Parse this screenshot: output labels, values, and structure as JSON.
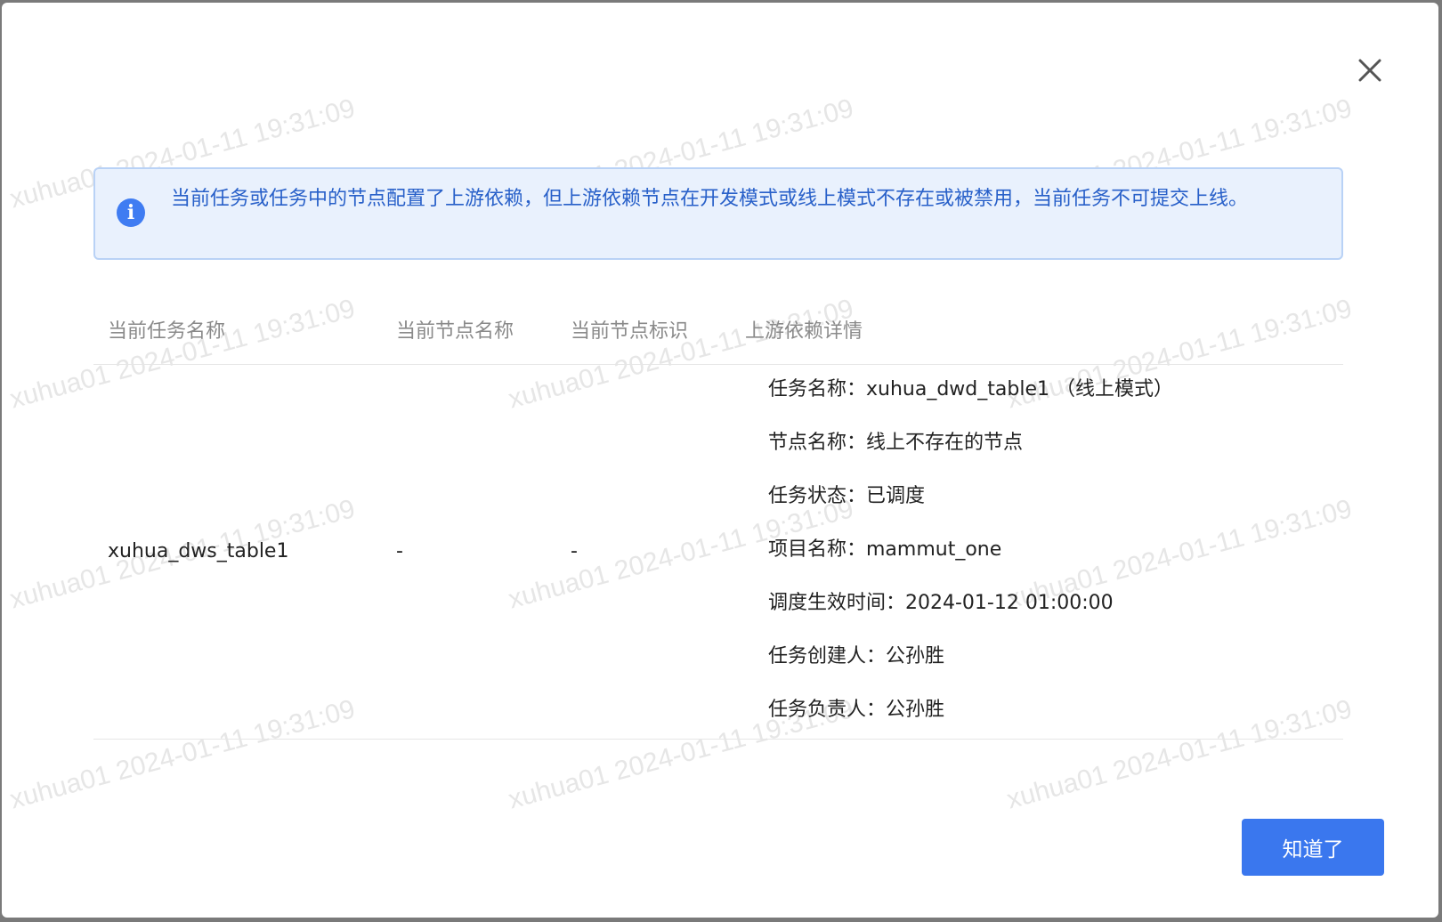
{
  "watermark": "xuhua01 2024-01-11 19:31:09",
  "alert": {
    "text": "当前任务或任务中的节点配置了上游依赖，但上游依赖节点在开发模式或线上模式不存在或被禁用，当前任务不可提交上线。",
    "icon": "info-icon",
    "color": "#3f7cf2"
  },
  "table": {
    "headers": [
      "当前任务名称",
      "当前节点名称",
      "当前节点标识",
      "上游依赖详情"
    ],
    "rows": [
      {
        "task_name": "xuhua_dws_table1",
        "node_name": "-",
        "node_id": "-",
        "details": [
          "任务名称：xuhua_dwd_table1 （线上模式）",
          "节点名称：线上不存在的节点",
          "任务状态：已调度",
          "项目名称：mammut_one",
          "调度生效时间：2024-01-12 01:00:00",
          "任务创建人：公孙胜",
          "任务负责人：公孙胜"
        ]
      }
    ]
  },
  "footer": {
    "ok_label": "知道了",
    "accent": "#3a77ee"
  }
}
